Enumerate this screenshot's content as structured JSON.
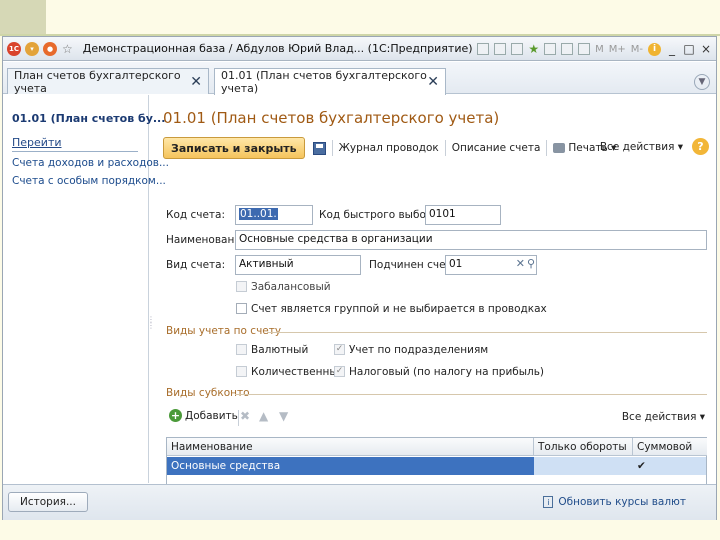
{
  "window": {
    "title": "Демонстрационная база / Абдулов Юрий Влад...  (1С:Предприятие)",
    "toolbar_labels": [
      "M",
      "M+",
      "M-"
    ],
    "minimize": "_",
    "maximize": "□",
    "close": "×"
  },
  "tabs": [
    {
      "label": "План счетов бухгалтерского учета",
      "close": "✕"
    },
    {
      "label": "01.01 (План счетов бухгалтерского учета)",
      "close": "✕",
      "active": true
    }
  ],
  "sidebar": {
    "title": "01.01 (План счетов бу...",
    "goto_label": "Перейти",
    "links": [
      "Счета доходов и расходов...",
      "Счета с особым порядком..."
    ]
  },
  "form": {
    "title": "01.01 (План счетов бухгалтерского учета)",
    "toolbar": {
      "save_close": "Записать и закрыть",
      "journal": "Журнал проводок",
      "description": "Описание счета",
      "print": "Печать ▾",
      "all_actions": "Все действия ▾",
      "help": "?"
    },
    "fields": {
      "code_label": "Код счета:",
      "code_value": "01..01.",
      "quick_code_label": "Код быстрого выбора:",
      "quick_code_value": "0101",
      "name_label": "Наименование:",
      "name_value": "Основные средства в организации",
      "type_label": "Вид счета:",
      "type_value": "Активный",
      "parent_label": "Подчинен счету:",
      "parent_value": "01"
    },
    "checkboxes": {
      "offbalance": {
        "label": "Забалансовый",
        "checked": false
      },
      "group": {
        "label": "Счет является группой и не выбирается в проводках",
        "checked": false
      }
    },
    "accounting_section": {
      "title": "Виды учета по счету",
      "currency": {
        "label": "Валютный",
        "checked": false
      },
      "by_division": {
        "label": "Учет по подразделениям",
        "checked": true
      },
      "quantity": {
        "label": "Количественный",
        "checked": false
      },
      "tax": {
        "label": "Налоговый (по налогу на прибыль)",
        "checked": true
      }
    },
    "subconto_section": {
      "title": "Виды субконто",
      "add_label": "Добавить",
      "all_actions": "Все действия ▾",
      "columns": [
        "Наименование",
        "Только обороты",
        "Суммовой"
      ],
      "rows": [
        {
          "name": "Основные средства",
          "turnover_only": "",
          "sum": "✔"
        }
      ]
    }
  },
  "statusbar": {
    "history": "История...",
    "update_rates": "Обновить курсы валют"
  }
}
